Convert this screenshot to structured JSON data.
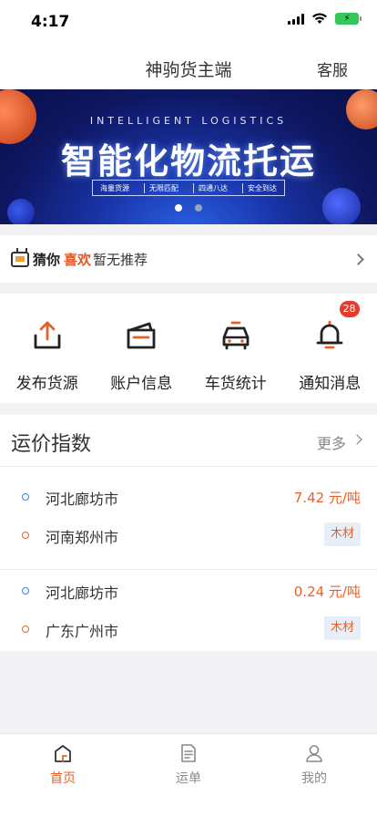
{
  "status": {
    "time": "4:17",
    "battery": "⚡"
  },
  "nav": {
    "title": "神驹货主端",
    "service": "客服"
  },
  "banner": {
    "subtitle": "INTELLIGENT LOGISTICS",
    "title": "智能化物流托运",
    "tags": [
      "海量货源",
      "无限匹配",
      "四通八达",
      "安全到达"
    ],
    "page_total": 2,
    "page_active": 1
  },
  "guess": {
    "label_a": "猜你",
    "label_b": "喜欢",
    "empty_text": "暂无推荐"
  },
  "quick": [
    {
      "label": "发布货源",
      "icon": "upload-icon"
    },
    {
      "label": "账户信息",
      "icon": "wallet-icon"
    },
    {
      "label": "车货统计",
      "icon": "car-icon"
    },
    {
      "label": "通知消息",
      "icon": "bell-icon",
      "badge": "28"
    }
  ],
  "freight": {
    "title": "运价指数",
    "more": "更多",
    "routes": [
      {
        "from": "河北廊坊市",
        "to": "河南郑州市",
        "price": "7.42 元/吨",
        "cargo": "木材"
      },
      {
        "from": "河北廊坊市",
        "to": "广东广州市",
        "price": "0.24 元/吨",
        "cargo": "木材"
      }
    ]
  },
  "tabs": [
    {
      "label": "首页",
      "icon": "home-icon",
      "active": true
    },
    {
      "label": "运单",
      "icon": "document-icon",
      "active": false
    },
    {
      "label": "我的",
      "icon": "user-icon",
      "active": false
    }
  ],
  "colors": {
    "accent": "#e8602a",
    "blue": "#3b82f6",
    "badge": "#e83a2a"
  }
}
